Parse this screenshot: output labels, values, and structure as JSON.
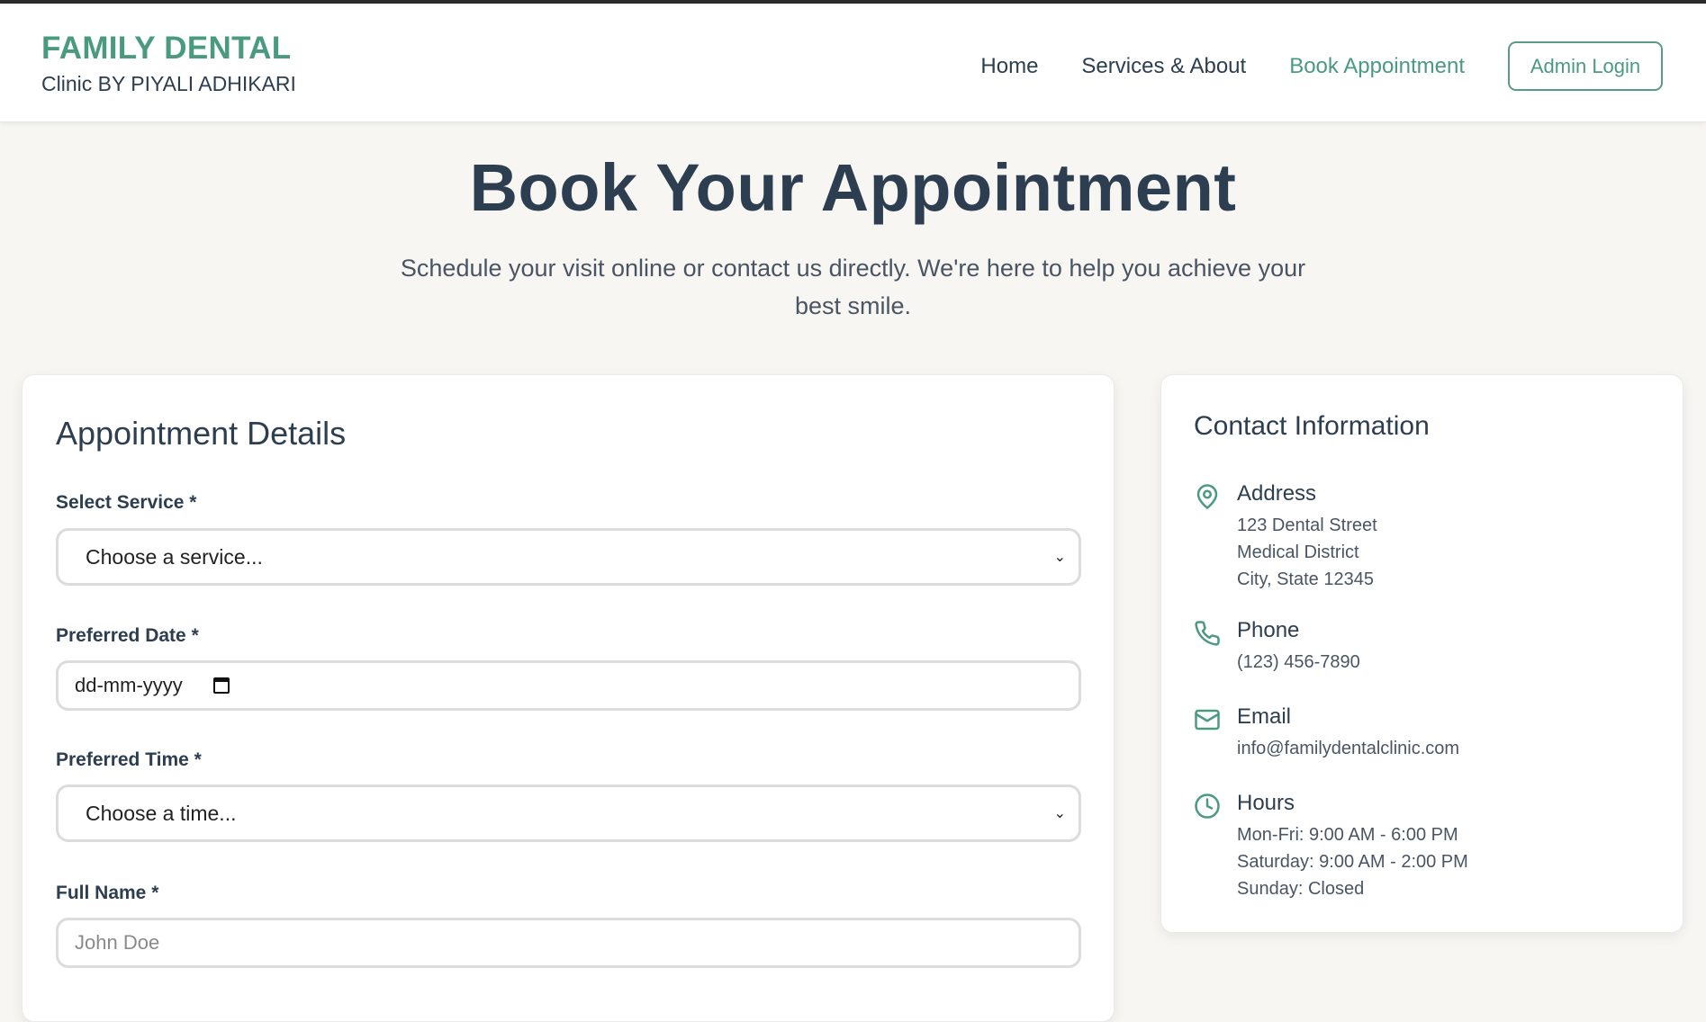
{
  "brand": {
    "title": "FAMILY DENTAL",
    "subtitle": "Clinic BY PIYALI ADHIKARI"
  },
  "nav": {
    "links": [
      "Home",
      "Services & About",
      "Book Appointment"
    ],
    "active": "Book Appointment",
    "admin_label": "Admin Login"
  },
  "hero": {
    "title": "Book Your Appointment",
    "subtitle": "Schedule your visit online or contact us directly. We're here to help you achieve your best smile."
  },
  "form": {
    "title": "Appointment Details",
    "service_label": "Select Service *",
    "service_value": "Choose a service...",
    "date_label": "Preferred Date *",
    "date_value": "dd-mm-yyyy",
    "time_label": "Preferred Time *",
    "time_value": "Choose a time...",
    "name_label": "Full Name *",
    "name_placeholder": "John Doe"
  },
  "contact": {
    "title": "Contact Information",
    "address_head": "Address",
    "address_lines": [
      "123 Dental Street",
      "Medical District",
      "City, State 12345"
    ],
    "phone_head": "Phone",
    "phone_value": "(123) 456-7890",
    "email_head": "Email",
    "email_value": "info@familydentalclinic.com",
    "hours_head": "Hours",
    "hours_lines": [
      "Mon-Fri: 9:00 AM - 6:00 PM",
      "Saturday: 9:00 AM - 2:00 PM",
      "Sunday: Closed"
    ]
  },
  "colors": {
    "accent": "#4a9a7f",
    "text": "#2c3e50",
    "background": "#f7f6f3"
  },
  "icons": {
    "address": "map-pin-icon",
    "phone": "phone-icon",
    "email": "mail-icon",
    "hours": "clock-icon"
  }
}
